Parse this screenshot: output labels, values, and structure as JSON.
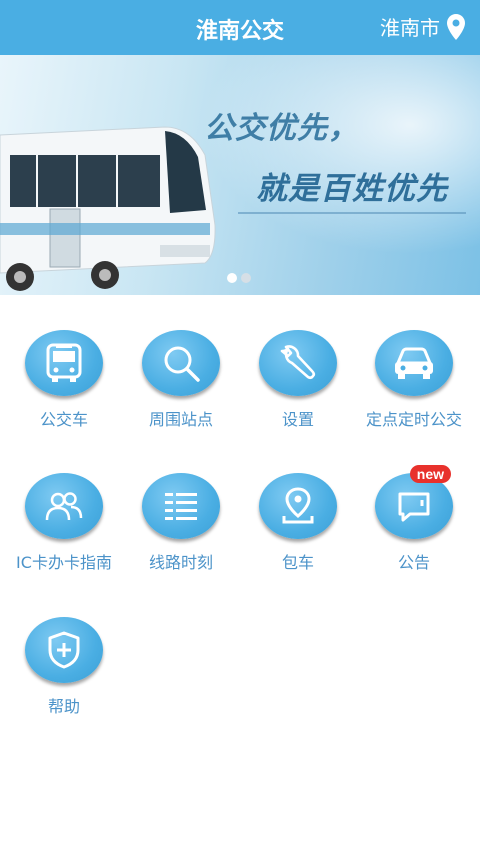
{
  "header": {
    "title": "淮南公交",
    "city": "淮南市",
    "city_icon": "location-pin-icon"
  },
  "banner": {
    "slogan_line1": "公交优先，",
    "slogan_line2": "就是百姓优先",
    "slide_count": 2,
    "active_slide": 1
  },
  "menu": [
    {
      "label": "公交车",
      "icon": "bus-icon"
    },
    {
      "label": "周围站点",
      "icon": "search-icon"
    },
    {
      "label": "设置",
      "icon": "wrench-icon"
    },
    {
      "label": "定点定时公交",
      "icon": "car-icon"
    },
    {
      "label": "IC卡办卡指南",
      "icon": "users-icon"
    },
    {
      "label": "线路时刻",
      "icon": "list-icon"
    },
    {
      "label": "包车",
      "icon": "location-pin-icon"
    },
    {
      "label": "公告",
      "icon": "chat-icon",
      "badge": "new"
    },
    {
      "label": "帮助",
      "icon": "shield-plus-icon"
    }
  ],
  "colors": {
    "accent": "#4aaee3",
    "label": "#4c93c9",
    "badge": "#e8312c"
  }
}
